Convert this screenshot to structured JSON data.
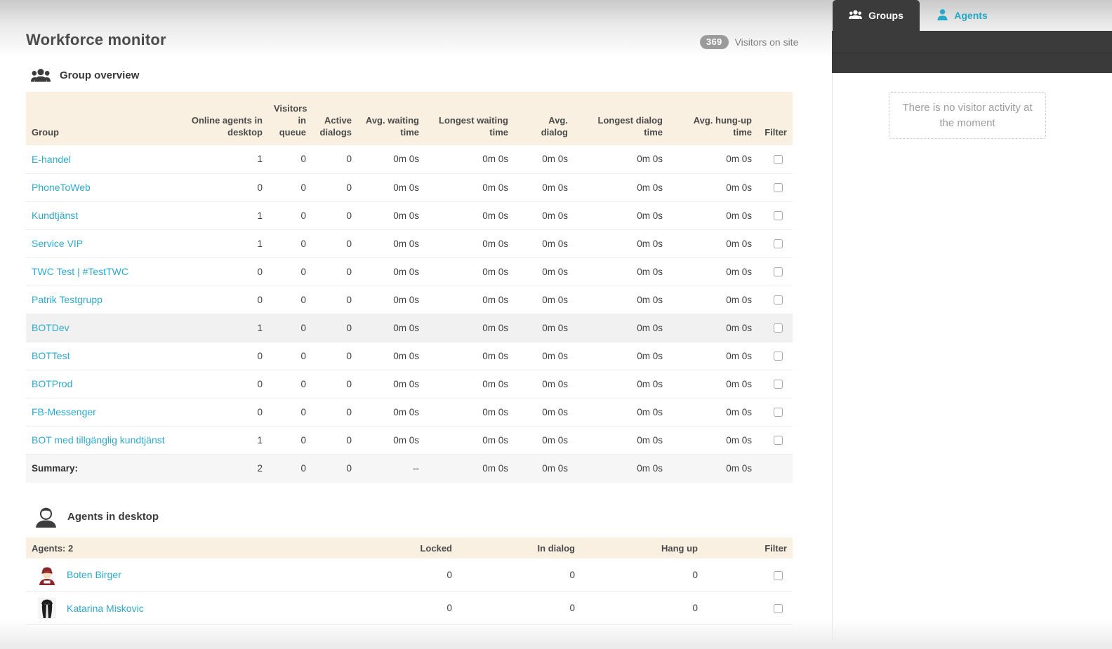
{
  "page": {
    "title": "Workforce monitor",
    "visitors_count": "369",
    "visitors_label": "Visitors on site"
  },
  "colors": {
    "accent": "#2fa9c9",
    "table_header_bg": "#faf0e1",
    "dark_tab": "#3b3b3b",
    "badge": "#9b9b9b",
    "row_highlight": "#f1f1f1"
  },
  "sidebar": {
    "tabs": [
      {
        "label": "Groups",
        "icon": "users-icon",
        "active": true
      },
      {
        "label": "Agents",
        "icon": "agent-icon",
        "active": false
      }
    ],
    "empty_message": "There is no visitor activity at the moment"
  },
  "group_overview": {
    "section_title": "Group overview",
    "columns": [
      "Group",
      "Online agents in desktop",
      "Visitors in queue",
      "Active dialogs",
      "Avg. waiting time",
      "Longest waiting time",
      "Avg. dialog",
      "Longest dialog time",
      "Avg. hung-up time",
      "Filter"
    ],
    "rows": [
      {
        "group": "E-handel",
        "online_agents": "1",
        "visitors_in_queue": "0",
        "active_dialogs": "0",
        "avg_waiting": "0m 0s",
        "longest_waiting": "0m 0s",
        "avg_dialog": "0m 0s",
        "longest_dialog": "0m 0s",
        "avg_hung_up": "0m 0s",
        "highlight": false
      },
      {
        "group": "PhoneToWeb",
        "online_agents": "0",
        "visitors_in_queue": "0",
        "active_dialogs": "0",
        "avg_waiting": "0m 0s",
        "longest_waiting": "0m 0s",
        "avg_dialog": "0m 0s",
        "longest_dialog": "0m 0s",
        "avg_hung_up": "0m 0s",
        "highlight": false
      },
      {
        "group": "Kundtjänst",
        "online_agents": "1",
        "visitors_in_queue": "0",
        "active_dialogs": "0",
        "avg_waiting": "0m 0s",
        "longest_waiting": "0m 0s",
        "avg_dialog": "0m 0s",
        "longest_dialog": "0m 0s",
        "avg_hung_up": "0m 0s",
        "highlight": false
      },
      {
        "group": "Service VIP",
        "online_agents": "1",
        "visitors_in_queue": "0",
        "active_dialogs": "0",
        "avg_waiting": "0m 0s",
        "longest_waiting": "0m 0s",
        "avg_dialog": "0m 0s",
        "longest_dialog": "0m 0s",
        "avg_hung_up": "0m 0s",
        "highlight": false
      },
      {
        "group": "TWC Test | #TestTWC",
        "online_agents": "0",
        "visitors_in_queue": "0",
        "active_dialogs": "0",
        "avg_waiting": "0m 0s",
        "longest_waiting": "0m 0s",
        "avg_dialog": "0m 0s",
        "longest_dialog": "0m 0s",
        "avg_hung_up": "0m 0s",
        "highlight": false
      },
      {
        "group": "Patrik Testgrupp",
        "online_agents": "0",
        "visitors_in_queue": "0",
        "active_dialogs": "0",
        "avg_waiting": "0m 0s",
        "longest_waiting": "0m 0s",
        "avg_dialog": "0m 0s",
        "longest_dialog": "0m 0s",
        "avg_hung_up": "0m 0s",
        "highlight": false
      },
      {
        "group": "BOTDev",
        "online_agents": "1",
        "visitors_in_queue": "0",
        "active_dialogs": "0",
        "avg_waiting": "0m 0s",
        "longest_waiting": "0m 0s",
        "avg_dialog": "0m 0s",
        "longest_dialog": "0m 0s",
        "avg_hung_up": "0m 0s",
        "highlight": true
      },
      {
        "group": "BOTTest",
        "online_agents": "0",
        "visitors_in_queue": "0",
        "active_dialogs": "0",
        "avg_waiting": "0m 0s",
        "longest_waiting": "0m 0s",
        "avg_dialog": "0m 0s",
        "longest_dialog": "0m 0s",
        "avg_hung_up": "0m 0s",
        "highlight": false
      },
      {
        "group": "BOTProd",
        "online_agents": "0",
        "visitors_in_queue": "0",
        "active_dialogs": "0",
        "avg_waiting": "0m 0s",
        "longest_waiting": "0m 0s",
        "avg_dialog": "0m 0s",
        "longest_dialog": "0m 0s",
        "avg_hung_up": "0m 0s",
        "highlight": false
      },
      {
        "group": "FB-Messenger",
        "online_agents": "0",
        "visitors_in_queue": "0",
        "active_dialogs": "0",
        "avg_waiting": "0m 0s",
        "longest_waiting": "0m 0s",
        "avg_dialog": "0m 0s",
        "longest_dialog": "0m 0s",
        "avg_hung_up": "0m 0s",
        "highlight": false
      },
      {
        "group": "BOT med tillgänglig kundtjänst",
        "online_agents": "1",
        "visitors_in_queue": "0",
        "active_dialogs": "0",
        "avg_waiting": "0m 0s",
        "longest_waiting": "0m 0s",
        "avg_dialog": "0m 0s",
        "longest_dialog": "0m 0s",
        "avg_hung_up": "0m 0s",
        "highlight": false
      }
    ],
    "summary": {
      "label": "Summary:",
      "online_agents": "2",
      "visitors_in_queue": "0",
      "active_dialogs": "0",
      "avg_waiting": "--",
      "longest_waiting": "0m 0s",
      "avg_dialog": "0m 0s",
      "longest_dialog": "0m 0s",
      "avg_hung_up": "0m 0s"
    }
  },
  "agents_section": {
    "section_title": "Agents in desktop",
    "header_label": "Agents: 2",
    "columns": [
      "Locked",
      "In dialog",
      "Hang up",
      "Filter"
    ],
    "rows": [
      {
        "name": "Boten Birger",
        "avatar": "red-cap-avatar",
        "locked": "0",
        "in_dialog": "0",
        "hang_up": "0"
      },
      {
        "name": "Katarina Miskovic",
        "avatar": "dog-avatar",
        "locked": "0",
        "in_dialog": "0",
        "hang_up": "0"
      }
    ]
  }
}
